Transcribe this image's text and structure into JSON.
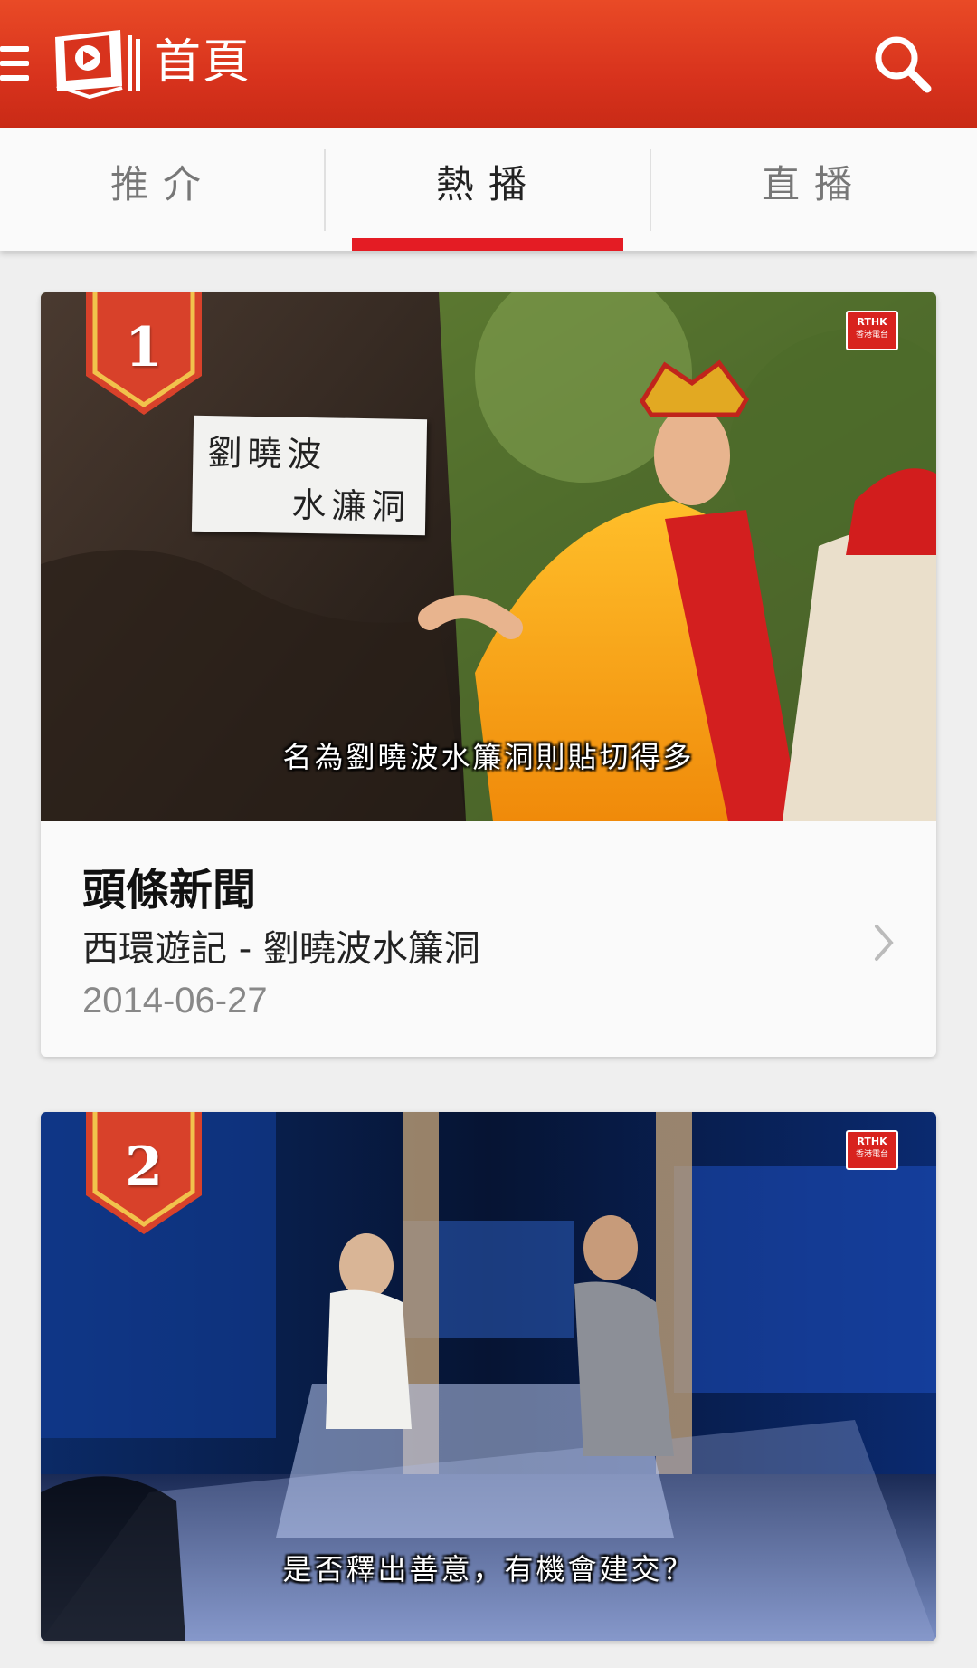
{
  "app_bar": {
    "title": "首頁"
  },
  "tabs": [
    {
      "label": "推介",
      "active": false
    },
    {
      "label": "熱播",
      "active": true
    },
    {
      "label": "直播",
      "active": false
    }
  ],
  "colors": {
    "app_bar": "#d8331d",
    "tab_indicator": "#e41c24",
    "rank_badge": "#d8412a"
  },
  "cards": [
    {
      "rank": "1",
      "broadcaster_badge": "RTHK",
      "broadcaster_badge_sub": "香港電台",
      "sign_line1": "劉曉波",
      "sign_line2": "水濂洞",
      "video_subtitle": "名為劉曉波水簾洞則貼切得多",
      "category": "頭條新聞",
      "title": "西環遊記 - 劉曉波水簾洞",
      "date": "2014-06-27"
    },
    {
      "rank": "2",
      "broadcaster_badge": "RTHK",
      "broadcaster_badge_sub": "香港電台",
      "video_subtitle": "是否釋出善意，有機會建交？"
    }
  ]
}
